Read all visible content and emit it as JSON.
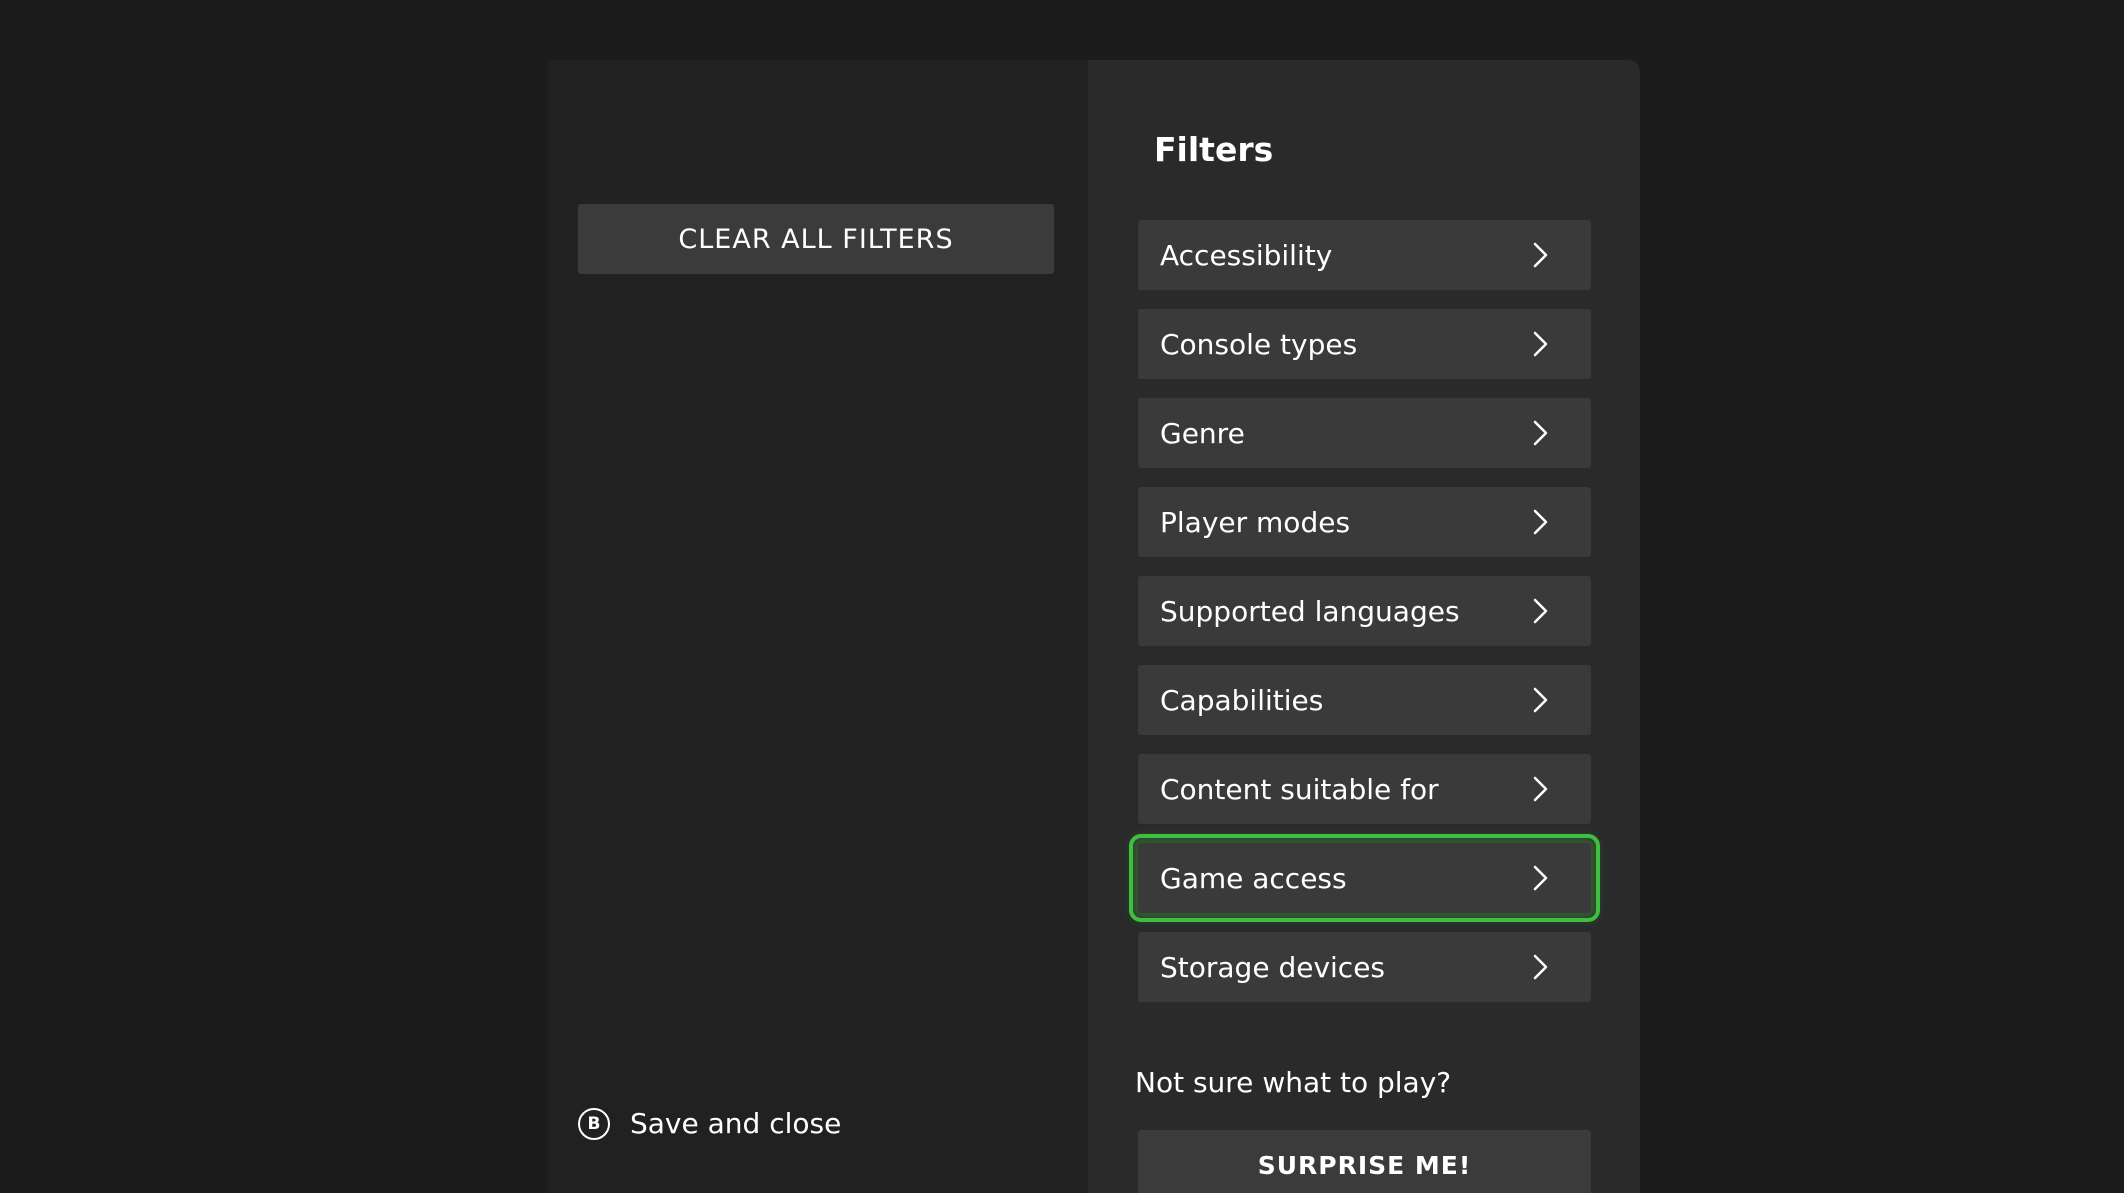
{
  "left": {
    "clear_all_label": "CLEAR ALL FILTERS",
    "save_close_button_glyph": "B",
    "save_close_label": "Save and close"
  },
  "filters": {
    "title": "Filters",
    "items": [
      {
        "label": "Accessibility"
      },
      {
        "label": "Console types"
      },
      {
        "label": "Genre"
      },
      {
        "label": "Player modes"
      },
      {
        "label": "Supported languages"
      },
      {
        "label": "Capabilities"
      },
      {
        "label": "Content suitable for"
      },
      {
        "label": "Game access",
        "selected": true
      },
      {
        "label": "Storage devices"
      }
    ],
    "chevron_icon": "chevron-right-icon",
    "focus_color": "#3fbf3f"
  },
  "prompt": {
    "text": "Not sure what to play?",
    "surprise_label": "SURPRISE ME!"
  }
}
